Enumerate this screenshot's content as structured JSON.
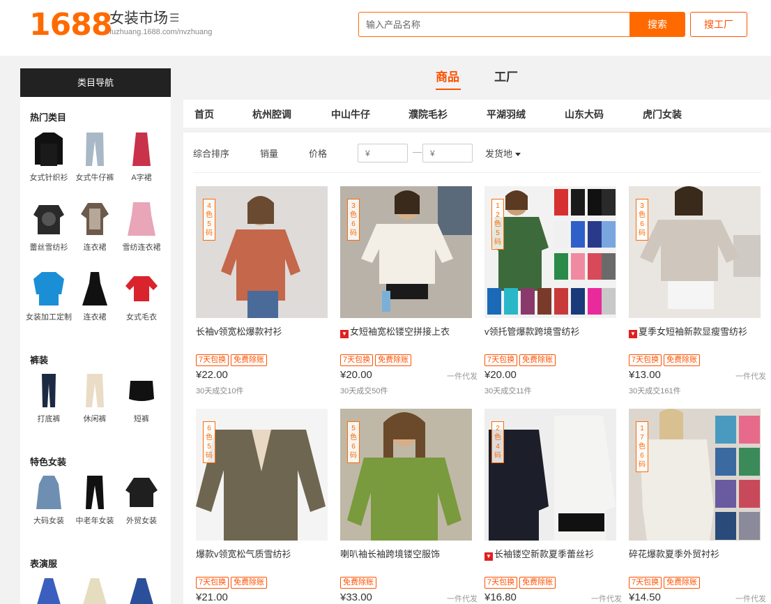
{
  "header": {
    "logo": "1688",
    "title": "女装市场",
    "url": "fuzhuang.1688.com/nvzhuang",
    "search_placeholder": "输入产品名称",
    "search_button": "搜索",
    "factory_button": "搜工厂",
    "accent_color": "#ff6a00"
  },
  "sidebar": {
    "heading": "类目导航",
    "sections": [
      {
        "title": "热门类目",
        "items": [
          "女式针织衫",
          "女式牛仔裤",
          "A字裙",
          "蕾丝雪纺衫",
          "连衣裙",
          "雪纺连衣裙",
          "女装加工定制",
          "连衣裙",
          "女式毛衣"
        ]
      },
      {
        "title": "裤装",
        "items": [
          "打底裤",
          "休闲裤",
          "短裤"
        ]
      },
      {
        "title": "特色女装",
        "items": [
          "大码女装",
          "中老年女装",
          "外贸女装"
        ]
      },
      {
        "title": "表演服",
        "items": []
      }
    ]
  },
  "main_tabs": [
    {
      "label": "商品",
      "active": true
    },
    {
      "label": "工厂",
      "active": false
    }
  ],
  "nav": [
    "首页",
    "杭州腔调",
    "中山牛仔",
    "濮院毛衫",
    "平湖羽绒",
    "山东大码",
    "虎门女装"
  ],
  "filters": {
    "sort": "综合排序",
    "sales": "销量",
    "price": "价格",
    "price_min": "¥",
    "price_max": "¥",
    "price_dash": "—",
    "ship_from": "发货地"
  },
  "products": [
    {
      "tag": "4色5码",
      "title": "长袖v领宽松爆款衬衫",
      "hot": false,
      "badges": [
        "7天包换",
        "免费除账"
      ],
      "price": "¥22.00",
      "dropship": "",
      "sales": "30天成交10件"
    },
    {
      "tag": "3色6码",
      "title": "女短袖宽松镂空拼接上衣",
      "hot": true,
      "badges": [
        "7天包换",
        "免费除账"
      ],
      "price": "¥20.00",
      "dropship": "一件代发",
      "sales": "30天成交50件"
    },
    {
      "tag": "12色5码",
      "title": "v领托管爆款跨境雪纺衫",
      "hot": false,
      "badges": [
        "7天包换",
        "免费除账"
      ],
      "price": "¥20.00",
      "dropship": "",
      "sales": "30天成交11件"
    },
    {
      "tag": "3色6码",
      "title": "夏季女短袖新款显瘦雪纺衫",
      "hot": true,
      "badges": [
        "7天包换",
        "免费除账"
      ],
      "price": "¥13.00",
      "dropship": "一件代发",
      "sales": "30天成交161件"
    },
    {
      "tag": "6色5码",
      "title": "爆款v领宽松气质雪纺衫",
      "hot": false,
      "badges": [
        "7天包换",
        "免费除账"
      ],
      "price": "¥21.00",
      "dropship": "",
      "sales": ""
    },
    {
      "tag": "5色6码",
      "title": "喇叭袖长袖跨境镂空服饰",
      "hot": false,
      "badges": [
        "免费除账"
      ],
      "price": "¥33.00",
      "dropship": "一件代发",
      "sales": ""
    },
    {
      "tag": "2色4码",
      "title": "长袖镂空新款夏季蕾丝衫",
      "hot": true,
      "badges": [
        "7天包换",
        "免费除账"
      ],
      "price": "¥16.80",
      "dropship": "一件代发",
      "sales": ""
    },
    {
      "tag": "17色6码",
      "title": "碎花爆款夏季外贸衬衫",
      "hot": false,
      "badges": [
        "7天包换",
        "免费除账"
      ],
      "price": "¥14.50",
      "dropship": "一件代发",
      "sales": ""
    }
  ]
}
